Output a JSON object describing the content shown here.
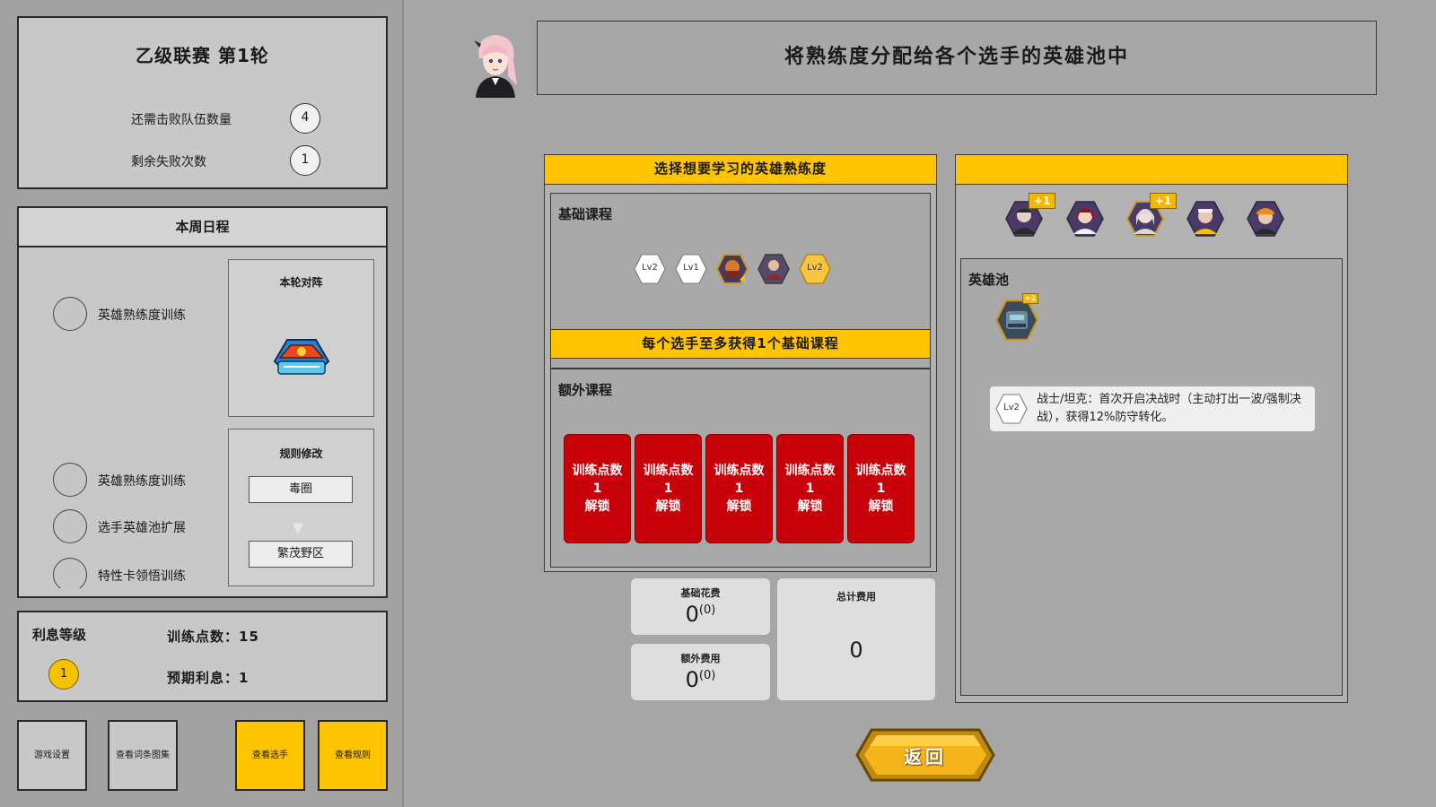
{
  "league": {
    "title": "乙级联赛 第1轮",
    "defeat_label": "还需击败队伍数量",
    "defeat_value": "4",
    "loss_label": "剩余失败次数",
    "loss_value": "1"
  },
  "schedule": {
    "header": "本周日程",
    "items": [
      {
        "label": "英雄熟练度训练"
      },
      {
        "label": "英雄熟练度训练"
      },
      {
        "label": "选手英雄池扩展"
      },
      {
        "label": "特性卡领悟训练"
      }
    ],
    "matchup_title": "本轮对阵",
    "rule_title": "规则修改",
    "rule_from": "毒圈",
    "rule_arrow": "▼",
    "rule_to": "繁茂野区"
  },
  "interest": {
    "title": "利息等级",
    "level": "1",
    "training_points": "训练点数：15",
    "expected_interest": "预期利息：1"
  },
  "bottom_buttons": {
    "settings": "游戏设置",
    "glossary": "查看词条图集",
    "players": "查看选手",
    "rules": "查看规则"
  },
  "instruction": "将熟练度分配给各个选手的英雄池中",
  "course": {
    "header": "选择想要学习的英雄熟练度",
    "basic_title": "基础课程",
    "basic_icons": [
      "Lv2",
      "Lv1",
      "",
      "",
      "Lv2"
    ],
    "basic_note": "每个选手至多获得1个基础课程",
    "extra_title": "额外课程",
    "unlock_cards": [
      {
        "line1": "训练点数",
        "line2": "1",
        "line3": "解锁"
      },
      {
        "line1": "训练点数",
        "line2": "1",
        "line3": "解锁"
      },
      {
        "line1": "训练点数",
        "line2": "1",
        "line3": "解锁"
      },
      {
        "line1": "训练点数",
        "line2": "1",
        "line3": "解锁"
      },
      {
        "line1": "训练点数",
        "line2": "1",
        "line3": "解锁"
      }
    ]
  },
  "costs": {
    "basic_label": "基础花费",
    "basic_value": "0",
    "basic_sup": "(0)",
    "extra_label": "额外费用",
    "extra_value": "0",
    "extra_sup": "(0)",
    "total_label": "总计费用",
    "total_value": "0"
  },
  "pool": {
    "header": "",
    "hero_badges": [
      "+1",
      "",
      "+1",
      "",
      ""
    ],
    "pool_title": "英雄池",
    "pool_badge": "+1",
    "trait_level": "Lv2",
    "trait_text": "战士/坦克：首次开启决战时（主动打出一波/强制决战），获得12%防守转化。"
  },
  "back_label": "返回",
  "colors": {
    "accent_yellow": "#ffc400",
    "unlock_red": "#c8000a",
    "panel_grey": "#c8c8c8"
  }
}
